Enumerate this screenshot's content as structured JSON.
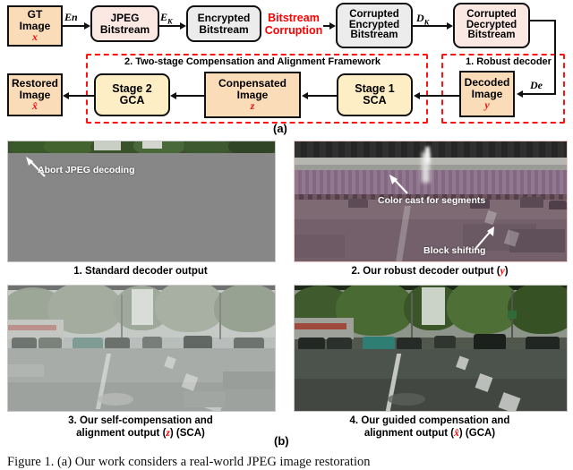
{
  "figure": {
    "caption": "Figure 1.  (a) Our work considers a real-world JPEG image restoration",
    "sublabel_a": "(a)",
    "sublabel_b": "(b)"
  },
  "diagram": {
    "nodes": [
      {
        "id": "gt",
        "lines": [
          "GT",
          "Image"
        ],
        "symbol": "x",
        "style": "peach"
      },
      {
        "id": "jpeg",
        "lines": [
          "JPEG",
          "Bitstream"
        ],
        "symbol": "",
        "style": "pink"
      },
      {
        "id": "enc",
        "lines": [
          "Encrypted",
          "Bitstream"
        ],
        "symbol": "",
        "style": "gray"
      },
      {
        "id": "cenc",
        "lines": [
          "Corrupted",
          "Encrypted",
          "Bitstream"
        ],
        "symbol": "",
        "style": "gray"
      },
      {
        "id": "cdec",
        "lines": [
          "Corrupted",
          "Decrypted",
          "Bitstream"
        ],
        "symbol": "",
        "style": "pink"
      },
      {
        "id": "decoded",
        "lines": [
          "Decoded",
          "Image"
        ],
        "symbol": "y",
        "style": "peach"
      },
      {
        "id": "stage1",
        "lines": [
          "Stage 1",
          "SCA"
        ],
        "symbol": "",
        "style": "cream"
      },
      {
        "id": "compimg",
        "lines": [
          "Conpensated",
          "Image"
        ],
        "symbol": "z",
        "style": "peach"
      },
      {
        "id": "stage2",
        "lines": [
          "Stage 2",
          "GCA"
        ],
        "symbol": "",
        "style": "cream"
      },
      {
        "id": "restored",
        "lines": [
          "Restored",
          "Image"
        ],
        "symbol": "x̂",
        "style": "peach"
      }
    ],
    "edge_labels": {
      "encode": "En",
      "encrypt_key": "EK",
      "decrypt_key": "DK",
      "decode": "De"
    },
    "corruption_label": [
      "Bitstream",
      "Corruption"
    ],
    "frames": [
      {
        "id": "robust-decoder",
        "title": "1. Robust decoder"
      },
      {
        "id": "two-stage",
        "title": "2. Two-stage Compensation and Alignment Framework"
      }
    ],
    "colors": {
      "peach": "#fadcb9",
      "pink": "#fce8e2",
      "gray": "#ececec",
      "cream": "#fdeec5",
      "red": "#ff0000",
      "outline": "#111111"
    }
  },
  "panels": [
    {
      "id": "standard-decoder",
      "caption_lines": [
        "1. Standard decoder output"
      ],
      "caption_symbol": "",
      "annotations": [
        {
          "text": "Abort JPEG decoding"
        }
      ]
    },
    {
      "id": "robust-decoder",
      "caption_lines": [
        "2. Our robust decoder output ("
      ],
      "caption_symbol": "y",
      "caption_tail": ")",
      "annotations": [
        {
          "text": "Color cast for segments"
        },
        {
          "text": "Block shifting"
        }
      ]
    },
    {
      "id": "sca-output",
      "caption_lines": [
        "3. Our self-compensation and",
        "alignment output ("
      ],
      "caption_symbol": "z",
      "caption_tail": ") (SCA)",
      "annotations": []
    },
    {
      "id": "gca-output",
      "caption_lines": [
        "4. Our guided compensation and",
        "alignment output ("
      ],
      "caption_symbol": "x̂",
      "caption_tail": ") (GCA)",
      "annotations": []
    }
  ]
}
